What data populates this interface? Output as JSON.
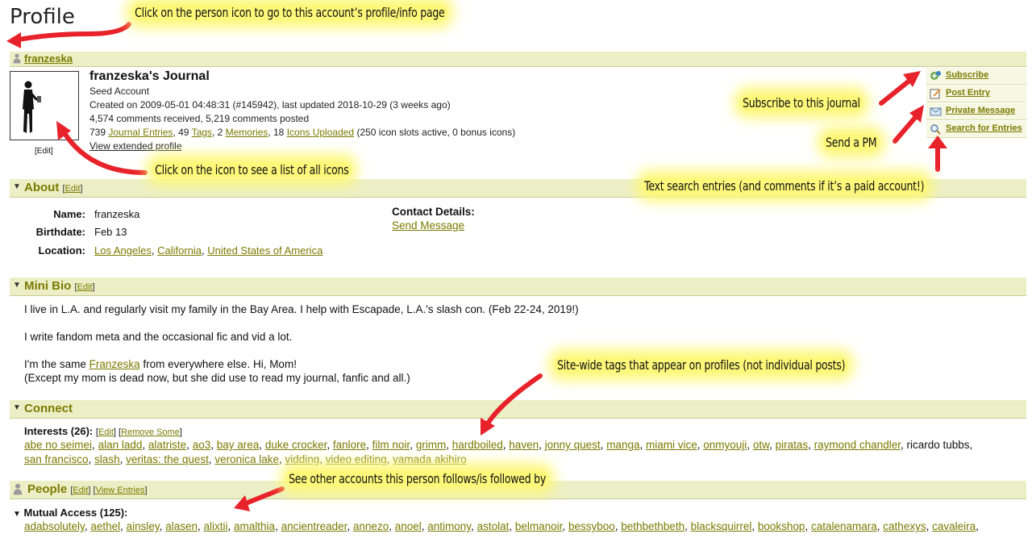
{
  "page_heading": "Profile",
  "annotations": {
    "profile_icon": "Click on the person icon to go to this account’s profile/info page",
    "icons_list": "Click on the icon to see a list of all icons",
    "subscribe": "Subscribe to this journal",
    "pm": "Send a PM",
    "search": "Text search entries (and comments if it’s a paid account!)",
    "tags": "Site-wide tags that appear on profiles (not individual posts)",
    "people": "See other accounts this person follows/is followed by"
  },
  "user": {
    "username": "franzeska",
    "journal_title": "franzeska's Journal",
    "account_type": "Seed Account",
    "created": "Created on 2009-05-01 04:48:31 (#145942), last updated 2018-10-29 (3 weeks ago)",
    "comments": "4,574 comments received, 5,219 comments posted",
    "stats": {
      "entries_count": "739",
      "entries_label": "Journal Entries",
      "tags_count": "49",
      "tags_label": "Tags",
      "memories_count": "2",
      "memories_label": "Memories",
      "icons_count": "18",
      "icons_label": "Icons Uploaded",
      "icons_note": "(250 icon slots active, 0 bonus icons)"
    },
    "extended_profile": "View extended profile",
    "icon_edit": "[Edit]"
  },
  "actions": [
    {
      "label": "Subscribe",
      "icon": "subscribe-icon"
    },
    {
      "label": "Post Entry",
      "icon": "post-entry-icon"
    },
    {
      "label": "Private Message",
      "icon": "envelope-icon"
    },
    {
      "label": "Search for Entries",
      "icon": "magnifier-icon"
    }
  ],
  "about": {
    "title": "About",
    "edit": "Edit",
    "name_label": "Name:",
    "name_value": "franzeska",
    "birthdate_label": "Birthdate:",
    "birthdate_value": "Feb 13",
    "location_label": "Location:",
    "location": [
      "Los Angeles",
      "California",
      "United States of America"
    ],
    "contact_label": "Contact Details:",
    "contact_link": "Send Message"
  },
  "mini_bio": {
    "title": "Mini Bio",
    "edit": "Edit",
    "line1": "I live in L.A. and regularly visit my family in the Bay Area. I help with Escapade, L.A.'s slash con. (Feb 22-24, 2019!)",
    "line2": "I write fandom meta and the occasional fic and vid a lot.",
    "line3_pre": "I'm the same ",
    "line3_link": "Franzeska",
    "line3_post": " from everywhere else. Hi, Mom!",
    "line4": "(Except my mom is dead now, but she did use to read my journal, fanfic and all.)"
  },
  "connect": {
    "title": "Connect",
    "interests_label": "Interests (26):",
    "edit": "Edit",
    "remove": "Remove Some",
    "interests_row1": [
      "abe no seimei",
      "alan ladd",
      "alatriste",
      "ao3",
      "bay area",
      "duke crocker",
      "fanlore",
      "film noir",
      "grimm",
      "hardboiled",
      "haven",
      "jonny quest",
      "manga",
      "miami vice",
      "onmyouji",
      "otw",
      "piratas",
      "raymond chandler"
    ],
    "interest_plain": "ricardo tubbs",
    "interests_row2": [
      "san francisco",
      "slash",
      "veritas: the quest",
      "veronica lake",
      "vidding",
      "video editing",
      "yamada akihiro"
    ]
  },
  "people": {
    "title": "People",
    "edit": "Edit",
    "view_entries": "View Entries",
    "mutual_label": "Mutual Access (125):",
    "mutual": [
      "adabsolutely",
      "aethel",
      "ainsley",
      "alasen",
      "alixtii",
      "amalthia",
      "ancientreader",
      "annezo",
      "anoel",
      "antimony",
      "astolat",
      "belmanoir",
      "bessyboo",
      "bethbethbeth",
      "blacksquirrel",
      "bookshop",
      "catalenamara",
      "cathexys",
      "cavaleira"
    ]
  },
  "colors": {
    "bar_bg": "#ecefc6",
    "link": "#7a7a00",
    "highlight": "#fdf87a",
    "arrow": "#e8222a"
  }
}
